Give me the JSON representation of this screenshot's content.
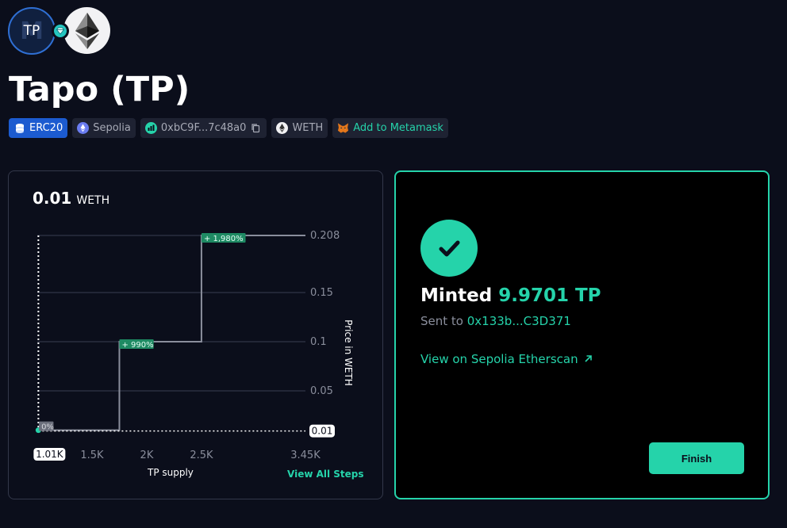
{
  "token": {
    "logo_text": "TP",
    "title": "Tapo (TP)"
  },
  "tags": {
    "standard": "ERC20",
    "network": "Sepolia",
    "address": "0xbC9F...7c48a0",
    "reserve": "WETH",
    "metamask": "Add to Metamask"
  },
  "chart": {
    "current_price": "0.01",
    "current_unit": "WETH",
    "view_all_steps": "View All Steps",
    "x_title": "TP supply",
    "y_title": "Price in WETH",
    "start_label": "1.01K",
    "current_label": "0.01"
  },
  "chart_data": {
    "type": "line",
    "step": true,
    "x": [
      1010,
      1750,
      2500,
      3450
    ],
    "y": [
      0.01,
      0.1,
      0.208,
      0.208
    ],
    "xlim": [
      1000,
      3450
    ],
    "ylim": [
      0,
      0.208
    ],
    "x_ticks": [
      "1.5K",
      "2K",
      "2.5K",
      "3.45K"
    ],
    "x_tick_values": [
      1500,
      2000,
      2500,
      3450
    ],
    "y_ticks": [
      "0.208",
      "0.15",
      "0.1",
      "0.05"
    ],
    "y_tick_values": [
      0.208,
      0.15,
      0.1,
      0.05
    ],
    "step_labels": [
      "0%",
      "+ 990%",
      "+ 1,980%"
    ],
    "xlabel": "TP supply",
    "ylabel": "Price in WETH",
    "grid": true
  },
  "mint": {
    "minted_label": "Minted",
    "amount": "9.9701 TP",
    "sent_label": "Sent to",
    "sent_address": "0x133b...C3D371",
    "etherscan_link": "View on Sepolia Etherscan",
    "finish_button": "Finish"
  },
  "colors": {
    "accent": "#25d3aa",
    "background": "#0b0e1b",
    "erc_badge": "#1c5bd0",
    "tag_bg": "#1e2232"
  }
}
